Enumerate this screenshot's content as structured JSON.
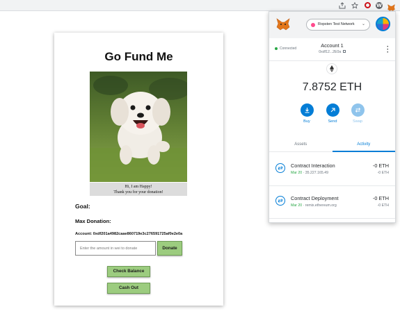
{
  "browser": {
    "icons": [
      "share-icon",
      "star-icon",
      "opera-icon",
      "w-extension-icon",
      "metamask-fox-icon"
    ],
    "w_icon_text": "W"
  },
  "dapp": {
    "title": "Go Fund Me",
    "image_caption_line1": "Hi, I am Happy!",
    "image_caption_line2": "Thank you for your donation!",
    "goal_label": "Goal:",
    "max_donation_label": "Max Donation:",
    "account_text": "Account: 0xdf201a4982caae860719e3c276591725af0e2e0a",
    "amount_placeholder": "Enter the amount in wei to donate",
    "donate_button": "Donate",
    "check_balance_button": "Check Balance",
    "cash_out_button": "Cash Out"
  },
  "metamask": {
    "network": "Ropsten Test Network",
    "connected": "Connected",
    "account_name": "Account 1",
    "account_address": "0xdf12...2E0a",
    "balance": "7.8752 ETH",
    "actions": [
      {
        "label": "Buy",
        "icon": "download-icon"
      },
      {
        "label": "Send",
        "icon": "arrow-up-right-icon"
      },
      {
        "label": "Swap",
        "icon": "swap-icon"
      }
    ],
    "tabs": [
      {
        "label": "Assets"
      },
      {
        "label": "Activity"
      }
    ],
    "transactions": [
      {
        "title": "Contract Interaction",
        "date": "Mar 20",
        "detail": "35.227.165.49",
        "amount": "-0 ETH",
        "amount_sub": "-0 ETH"
      },
      {
        "title": "Contract Deployment",
        "date": "Mar 20",
        "detail": "remix.ethereum.org",
        "amount": "-0 ETH",
        "amount_sub": "-0 ETH"
      }
    ],
    "colors": {
      "accent": "#037dd6",
      "network_dot": "#ff4a8d",
      "connected_dot": "#28a745"
    }
  }
}
